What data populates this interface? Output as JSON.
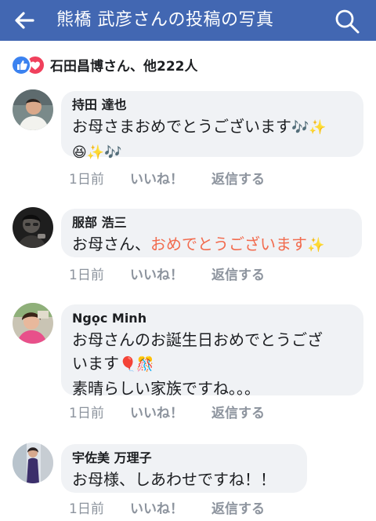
{
  "header": {
    "title": "熊橋 武彦さんの投稿の写真"
  },
  "reactions": {
    "summary": "石田昌博さん、他222人",
    "like_color": "#3b82f0",
    "love_color": "#f0405c"
  },
  "actions_labels": {
    "time": "1日前",
    "like": "いいね！",
    "reply": "返信する"
  },
  "comments": [
    {
      "name": "持田 達也",
      "line1": "お母さまおめでとうございます",
      "line1_emoji": "🎶✨",
      "line2_emoji": "😆✨🎶"
    },
    {
      "name": "服部 浩三",
      "text_plain": "お母さん、",
      "text_highlight": "おめでとうございます",
      "emoji": "✨",
      "highlight_color": "#f26b4e"
    },
    {
      "name": "Ngọc Minh",
      "line1": "お母さんのお誕生日おめでとうござ",
      "line2": "います",
      "line2_emoji": "🎈🎊",
      "line3": "素晴らしい家族ですね。。。"
    },
    {
      "name": "宇佐美 万理子",
      "line1": "お母様、しあわせですね！！"
    }
  ],
  "colors": {
    "header_bg": "#4267b2",
    "bubble_bg": "#f0f2f5",
    "meta_text": "#8d949e"
  }
}
